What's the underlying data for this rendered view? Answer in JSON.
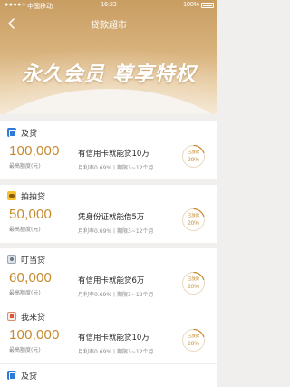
{
  "status_bar": {
    "signal": "●●●●○",
    "carrier": "中国移动",
    "time": "16:22",
    "battery": "100%"
  },
  "nav": {
    "title": "贷款超市"
  },
  "banner": {
    "title": "永久会员 尊享特权"
  },
  "loans": [
    {
      "name": "及贷",
      "logo": "blue-square-logo",
      "amount": "100,000",
      "amount_caption": "最高额度(元)",
      "feature": "有信用卡就能贷10万",
      "details": "月利率0.69%丨期限3~12个月",
      "badge_label": "已放款",
      "badge_value": "20%",
      "progress": 0.2
    },
    {
      "name": "拍拍贷",
      "logo": "yellow-logo",
      "amount": "50,000",
      "amount_caption": "最高额度(元)",
      "feature": "凭身份证就能借5万",
      "details": "月利率0.69%丨期限3~12个月",
      "badge_label": "已放款",
      "badge_value": "20%",
      "progress": 0.2
    },
    {
      "name": "叮当贷",
      "logo": "gray-logo",
      "amount": "60,000",
      "amount_caption": "最高额度(元)",
      "feature": "有信用卡就能贷6万",
      "details": "月利率0.69%丨期限3~12个月",
      "badge_label": "已放款",
      "badge_value": "20%",
      "progress": 0.2
    },
    {
      "name": "我来贷",
      "logo": "red-logo",
      "amount": "100,000",
      "amount_caption": "最高额度(元)",
      "feature": "有信用卡就能贷10万",
      "details": "月利率0.69%丨期限3~12个月",
      "badge_label": "已放款",
      "badge_value": "20%",
      "progress": 0.2
    },
    {
      "name": "及贷",
      "logo": "blue-square-logo"
    }
  ],
  "colors": {
    "accent": "#c58a2e",
    "header_top": "#c89d62",
    "ring_track": "#ead9c0"
  }
}
